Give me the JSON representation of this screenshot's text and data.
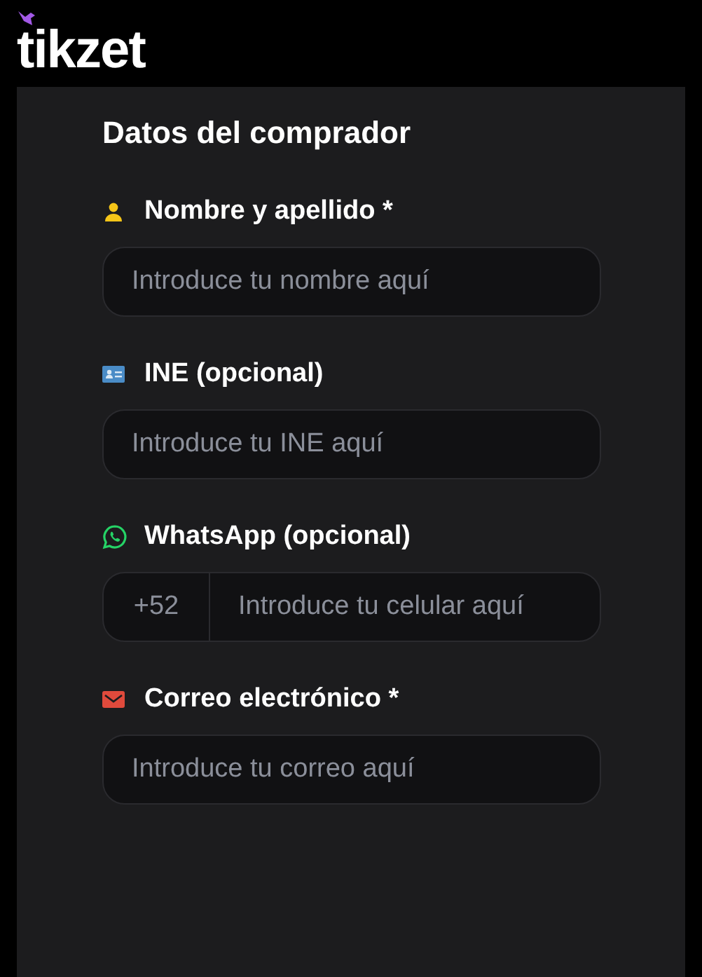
{
  "header": {
    "logo": "tikzet"
  },
  "form": {
    "title": "Datos del comprador",
    "fields": [
      {
        "kind": "text",
        "label": "Nombre y apellido *",
        "placeholder": "Introduce tu nombre aquí"
      },
      {
        "kind": "text",
        "label": "INE (opcional)",
        "placeholder": "Introduce tu INE aquí"
      },
      {
        "kind": "phone",
        "label": "WhatsApp (opcional)",
        "prefix": "+52",
        "placeholder": "Introduce tu celular aquí"
      },
      {
        "kind": "text",
        "label": "Correo electrónico *",
        "placeholder": "Introduce tu correo aquí"
      }
    ]
  }
}
